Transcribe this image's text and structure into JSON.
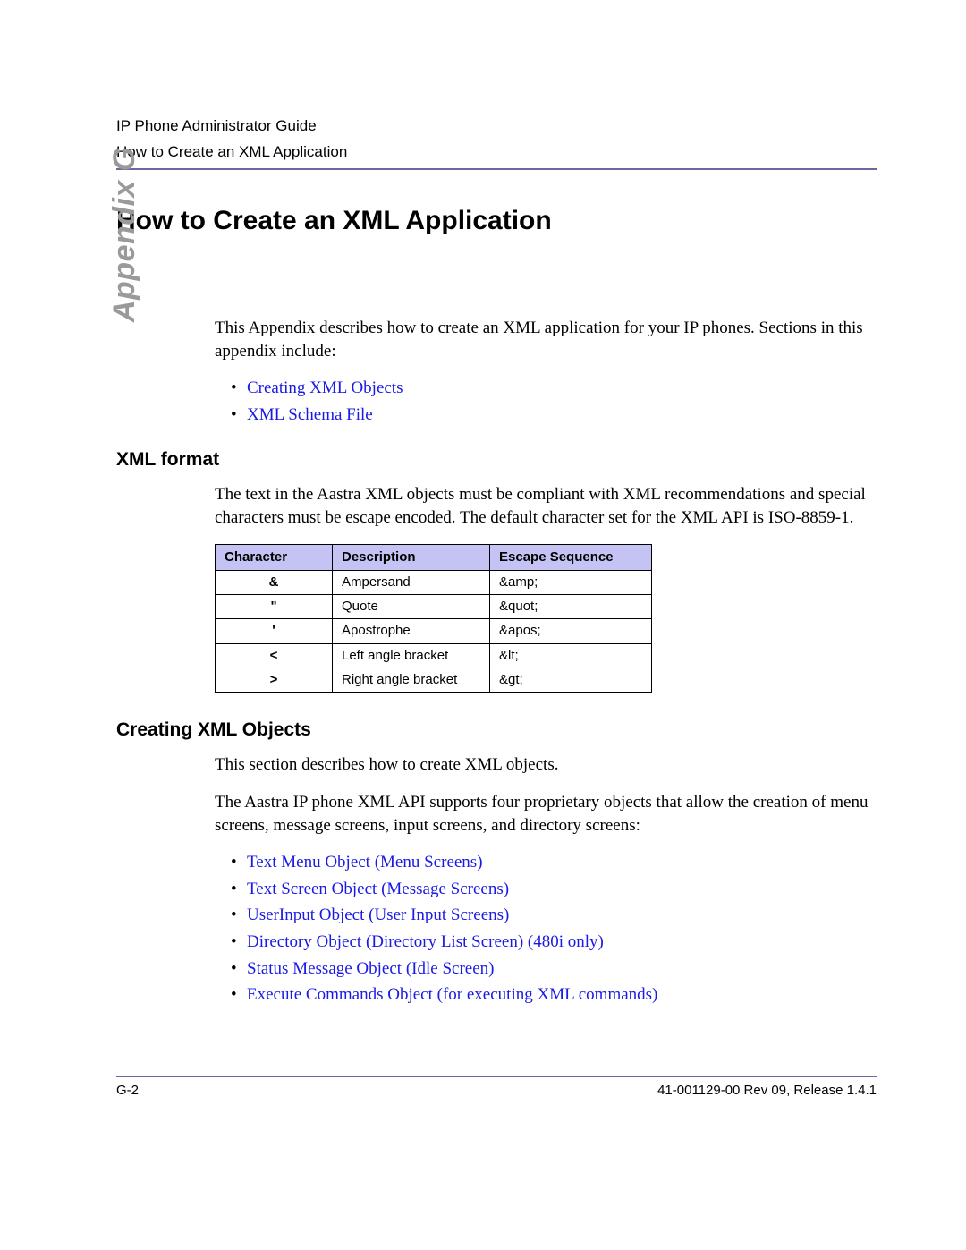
{
  "header": {
    "line1": "IP Phone Administrator Guide",
    "line2": "How to Create an XML Application"
  },
  "sidebar_label": "Appendix G",
  "title": "How to Create an XML Application",
  "intro": "This Appendix describes how to create an XML application for your IP phones. Sections in this appendix include:",
  "intro_links": [
    "Creating XML Objects",
    "XML Schema File"
  ],
  "section1": {
    "heading": "XML format",
    "para": "The text in the Aastra XML objects must be compliant with XML recommendations and special characters must be escape encoded. The default character set for the XML API is ISO-8859-1.",
    "table": {
      "headers": [
        "Character",
        "Description",
        "Escape Sequence"
      ],
      "rows": [
        {
          "char": "&",
          "desc": "Ampersand",
          "esc": "&amp;"
        },
        {
          "char": "\"",
          "desc": "Quote",
          "esc": "&quot;"
        },
        {
          "char": "'",
          "desc": "Apostrophe",
          "esc": "&apos;"
        },
        {
          "char": "<",
          "desc": "Left angle bracket",
          "esc": "&lt;"
        },
        {
          "char": ">",
          "desc": "Right angle bracket",
          "esc": "&gt;"
        }
      ]
    }
  },
  "section2": {
    "heading": "Creating XML Objects",
    "para1": "This section describes how to create XML objects.",
    "para2": "The Aastra IP phone XML API supports four proprietary objects that allow the creation of menu screens, message screens, input screens, and directory screens:",
    "links": [
      "Text Menu Object (Menu Screens)",
      "Text Screen Object (Message Screens)",
      "UserInput Object (User Input Screens)",
      "Directory Object (Directory List Screen) (480i only)",
      "Status Message Object (Idle Screen)",
      "Execute Commands Object (for executing XML commands)"
    ]
  },
  "footer": {
    "left": "G-2",
    "right": "41-001129-00 Rev 09, Release 1.4.1"
  }
}
